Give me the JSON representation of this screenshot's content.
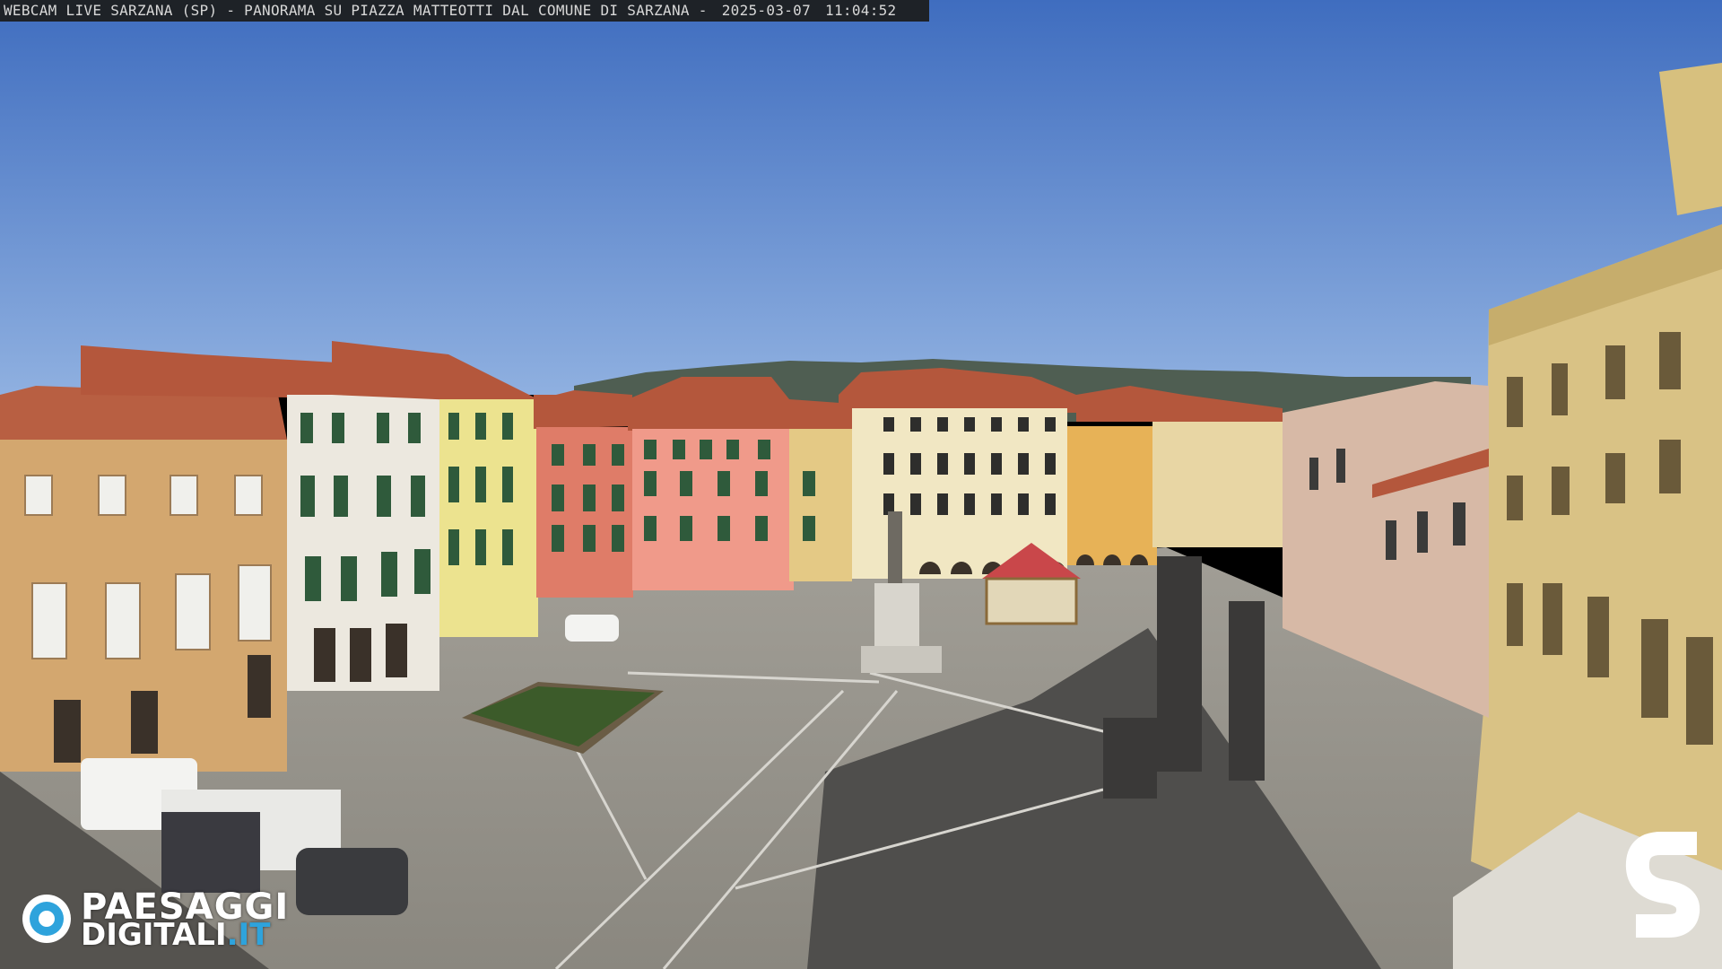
{
  "overlay": {
    "caption_parts": [
      "WEBCAM LIVE SARZANA (SP) - PANORAMA SU PIAZZA MATTEOTTI DAL COMUNE DI SARZANA -",
      "2025-03-07",
      "11:04:52"
    ]
  },
  "branding": {
    "left_logo_line1": "PAESAGGI",
    "left_logo_line2_main": "DIGITALI",
    "left_logo_line2_accent": ".IT",
    "left_logo_icon": "eye-icon",
    "right_logo_icon": "s-logo-icon",
    "accent_color": "#2ea3dc"
  },
  "scene": {
    "sky_color": "#5b8ad4",
    "pavement_color": "#8f8d86",
    "shadow_color": "#4b4a49"
  }
}
